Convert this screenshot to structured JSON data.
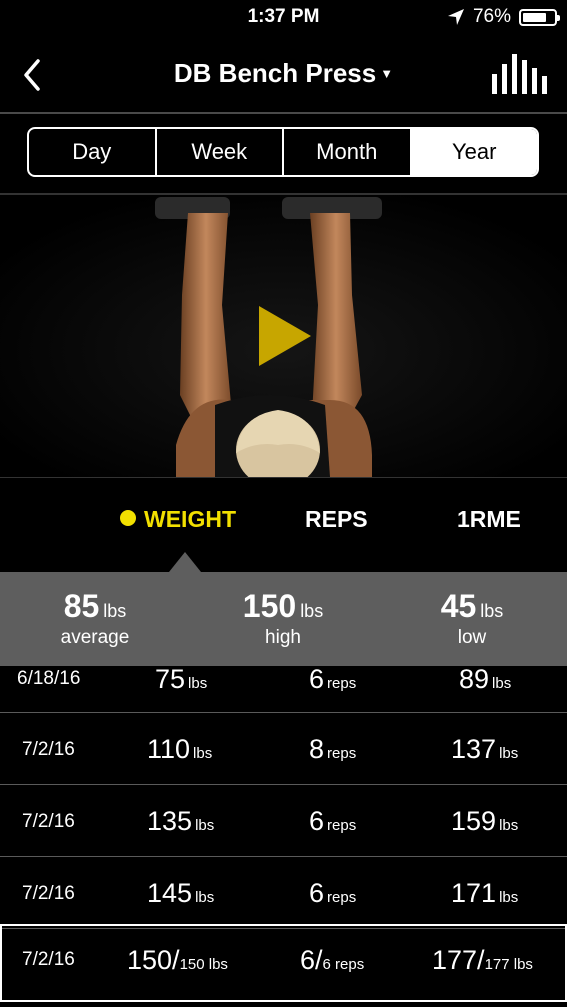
{
  "status_bar": {
    "time": "1:37 PM",
    "battery": "76%",
    "battery_level": 0.76
  },
  "header": {
    "title": "DB Bench Press"
  },
  "periods": [
    "Day",
    "Week",
    "Month",
    "Year"
  ],
  "active_period": "Year",
  "metric_tabs": [
    "WEIGHT",
    "REPS",
    "1RME"
  ],
  "active_metric": "WEIGHT",
  "summary": {
    "average": {
      "value": "85",
      "unit": "lbs",
      "label": "average"
    },
    "high": {
      "value": "150",
      "unit": "lbs",
      "label": "high"
    },
    "low": {
      "value": "45",
      "unit": "lbs",
      "label": "low"
    }
  },
  "rows": [
    {
      "date": "6/18/16",
      "weight": "75",
      "weight_unit": "lbs",
      "reps": "6",
      "reps_unit": "reps",
      "orm": "89",
      "orm_unit": "lbs"
    },
    {
      "date": "7/2/16",
      "weight": "110",
      "weight_unit": "lbs",
      "reps": "8",
      "reps_unit": "reps",
      "orm": "137",
      "orm_unit": "lbs"
    },
    {
      "date": "7/2/16",
      "weight": "135",
      "weight_unit": "lbs",
      "reps": "6",
      "reps_unit": "reps",
      "orm": "159",
      "orm_unit": "lbs"
    },
    {
      "date": "7/2/16",
      "weight": "145",
      "weight_unit": "lbs",
      "reps": "6",
      "reps_unit": "reps",
      "orm": "171",
      "orm_unit": "lbs"
    }
  ],
  "selected_row": {
    "date": "7/2/16",
    "weight": "150/",
    "weight_unit": "150 lbs",
    "reps": "6/",
    "reps_unit": "6 reps",
    "orm": "177/",
    "orm_unit": "177 lbs"
  },
  "colors": {
    "accent": "#f2e000",
    "summary_bg": "#5e5e5e",
    "background": "#000000"
  }
}
